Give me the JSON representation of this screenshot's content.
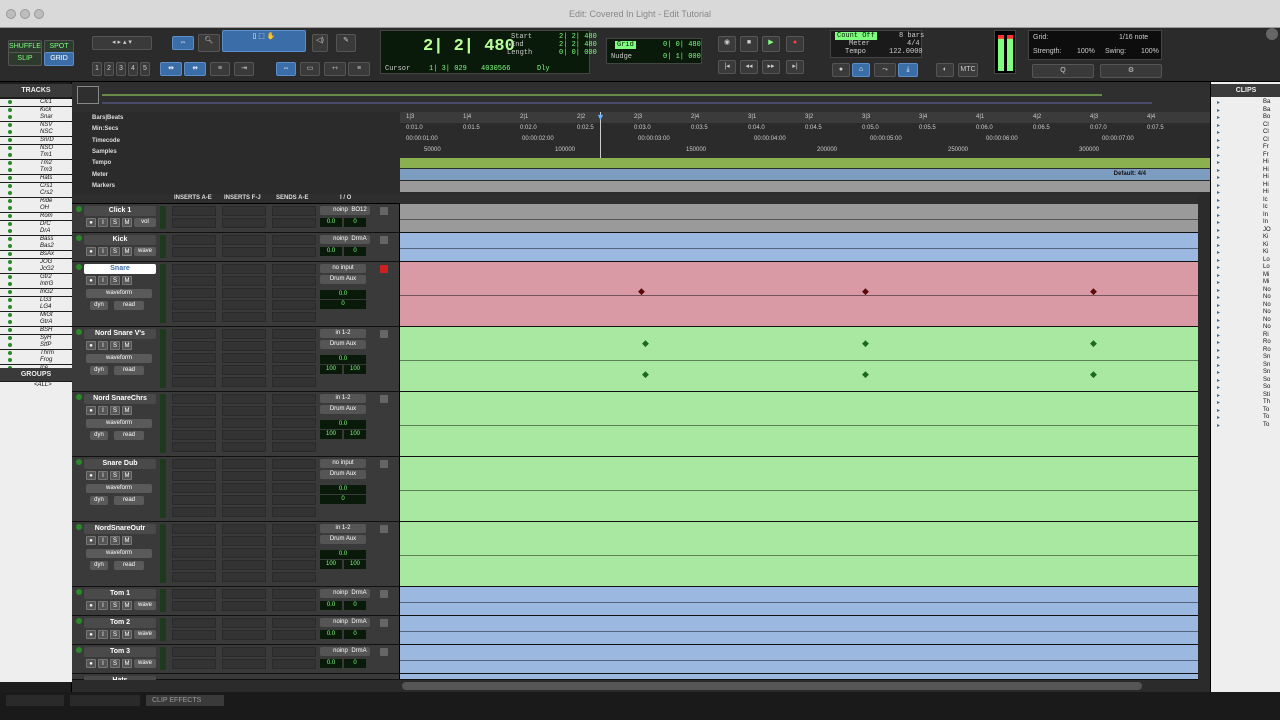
{
  "window": {
    "title": "Edit: Covered In Light - Edit Tutorial"
  },
  "toolbar": {
    "modes": [
      "SHUFFLE",
      "SPOT",
      "SLIP",
      "GRID"
    ],
    "zoom_presets": [
      "1",
      "2",
      "3",
      "4",
      "5"
    ],
    "counter": {
      "main": "2| 2| 480",
      "cursor_label": "Cursor",
      "cursor_value": "1| 3| 029",
      "sample": "4030566",
      "dly": "Dly"
    },
    "selection": {
      "start_label": "Start",
      "end_label": "End",
      "length_label": "Length",
      "start": "2| 2| 480",
      "end": "2| 2| 480",
      "length": "0| 0| 000"
    },
    "grid": {
      "label": "Grid",
      "value": "0| 0| 480",
      "nudge_label": "Nudge",
      "nudge_value": "0| 1| 000"
    },
    "count": {
      "count_off": "Count Off",
      "bars": "8 bars",
      "meter_label": "Meter",
      "meter": "4/4",
      "tempo_label": "Tempo",
      "tempo": "122.0000"
    },
    "grid_panel": {
      "grid_label": "Grid:",
      "grid_value": "1/16 note",
      "strength_label": "Strength:",
      "strength": "100%",
      "swing_label": "Swing:",
      "swing": "100%"
    },
    "mtc": "MTC"
  },
  "tracks_panel": {
    "title": "TRACKS",
    "items": [
      "Clc1",
      "Kick",
      "Snar",
      "NSV",
      "NSC",
      "SnrD",
      "NSO",
      "Tm1",
      "Tm2",
      "Tm3",
      "Hats",
      "Crs1",
      "Crs2",
      "Ride",
      "OH",
      "Rom",
      "DrC",
      "DrA",
      "Bass",
      "Bas2",
      "BsAx",
      "JOG",
      "JcG2",
      "Gtr2",
      "IntrG",
      "InG2",
      "LG3",
      "LG4",
      "MiGt",
      "GtrA",
      "BSH",
      "SyH",
      "StfP",
      "Thrm",
      "Frog",
      "Ice"
    ]
  },
  "groups_panel": {
    "title": "GROUPS",
    "item": "<ALL>"
  },
  "clips_panel": {
    "title": "CLIPS",
    "items": [
      "Ba",
      "Ba",
      "Bo",
      "Cl",
      "Cl",
      "Cl",
      "Fr",
      "Fr",
      "Hi",
      "Hi",
      "Hi",
      "Hi",
      "Hi",
      "Ic",
      "Ic",
      "In",
      "In",
      "JO",
      "Ki",
      "Ki",
      "Ki",
      "Lo",
      "Lo",
      "Mi",
      "Mi",
      "No",
      "No",
      "No",
      "No",
      "No",
      "No",
      "Ri",
      "Ro",
      "Ro",
      "Sn",
      "Sn",
      "Sn",
      "So",
      "So",
      "Sti",
      "Th",
      "To",
      "To",
      "To"
    ]
  },
  "rulers": {
    "names": [
      "Bars|Beats",
      "Min:Secs",
      "Timecode",
      "Samples",
      "Tempo",
      "Meter",
      "Markers"
    ],
    "bars": [
      "1|3",
      "1|4",
      "2|1",
      "2|2",
      "2|3",
      "2|4",
      "3|1",
      "3|2",
      "3|3",
      "3|4",
      "4|1",
      "4|2",
      "4|3",
      "4|4"
    ],
    "minsecs": [
      "0:01.0",
      "0:01.5",
      "0:02.0",
      "0:02.5",
      "0:03.0",
      "0:03.5",
      "0:04.0",
      "0:04.5",
      "0:05.0",
      "0:05.5",
      "0:06.0",
      "0:06.5",
      "0:07.0",
      "0:07.5"
    ],
    "timecode": [
      "00:00:01:00",
      "00:00:02:00",
      "00:00:03:00",
      "00:00:04:00",
      "00:00:05:00",
      "00:00:06:00",
      "00:00:07:00"
    ],
    "samples": [
      "50000",
      "100000",
      "150000",
      "200000",
      "250000",
      "300000"
    ],
    "meter_default": "Default: 4/4"
  },
  "columns": {
    "inserts_ae": "INSERTS A-E",
    "inserts_fj": "INSERTS F-J",
    "sends_ae": "SENDS A-E",
    "io": "I / O"
  },
  "tracks": [
    {
      "name": "Click 1",
      "in": "noinput",
      "out": "BO12",
      "vol": "0.0",
      "pan": "0",
      "mode": "vol",
      "rec": "read",
      "color": "#9a9a9a"
    },
    {
      "name": "Kick",
      "in": "noinput",
      "out": "DrmA",
      "vol": "0.0",
      "pan": "0",
      "mode": "wave",
      "rec": "read",
      "color": "#9ab8e0"
    },
    {
      "name": "Snare",
      "in": "no input",
      "out": "Drum Aux",
      "vol": "0.0",
      "pan": "0",
      "mode": "waveform",
      "dyn": "dyn",
      "rec": "read",
      "color": "#d99aa6"
    },
    {
      "name": "Nord Snare V's",
      "in": "in 1-2",
      "out": "Drum Aux",
      "vol": "0.0",
      "panL": "100",
      "panR": "100",
      "mode": "waveform",
      "dyn": "dyn",
      "rec": "read",
      "color": "#a8e8a0"
    },
    {
      "name": "Nord SnareChrs",
      "in": "in 1-2",
      "out": "Drum Aux",
      "vol": "0.0",
      "panL": "100",
      "panR": "100",
      "mode": "waveform",
      "dyn": "dyn",
      "rec": "read",
      "color": "#a8e8a0"
    },
    {
      "name": "Snare Dub",
      "in": "no input",
      "out": "Drum Aux",
      "vol": "0.0",
      "pan": "0",
      "mode": "waveform",
      "dyn": "dyn",
      "rec": "read",
      "color": "#a8e8a0"
    },
    {
      "name": "NordSnareOutr",
      "in": "in 1-2",
      "out": "Drum Aux",
      "vol": "0.0",
      "panL": "100",
      "panR": "100",
      "mode": "waveform",
      "dyn": "dyn",
      "rec": "read",
      "color": "#a8e8a0"
    },
    {
      "name": "Tom 1",
      "in": "noinput",
      "out": "DrmA",
      "vol": "0.0",
      "pan": "0",
      "mode": "wave",
      "rec": "read",
      "color": "#9ab8e0"
    },
    {
      "name": "Tom 2",
      "in": "noinput",
      "out": "DrmA",
      "vol": "0.0",
      "pan": "0",
      "mode": "wave",
      "rec": "read",
      "color": "#9ab8e0"
    },
    {
      "name": "Tom 3",
      "in": "noinput",
      "out": "DrmA",
      "vol": "0.0",
      "pan": "0",
      "mode": "wave",
      "rec": "read",
      "color": "#9ab8e0"
    },
    {
      "name": "Hats",
      "color": "#9ab8e0"
    }
  ],
  "bottom_tabs": [
    "CLIP EFFECTS"
  ]
}
